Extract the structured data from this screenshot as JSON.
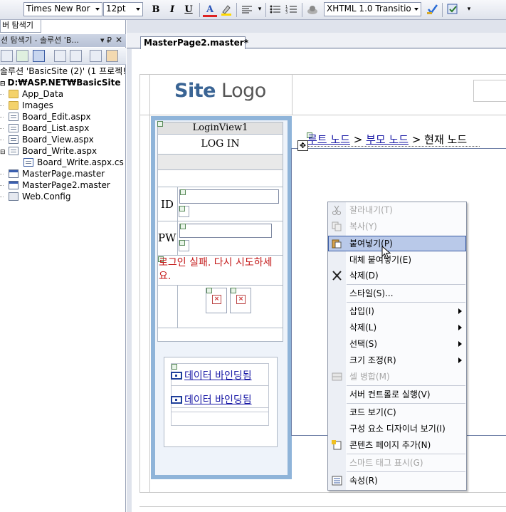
{
  "toolbar": {
    "font_name": "Times New Ror",
    "font_size": "12pt",
    "bold": "B",
    "italic": "I",
    "underline": "U",
    "doctype": "XHTML 1.0 Transitio"
  },
  "solution_explorer": {
    "tab_label": "버 탐색기",
    "title": "션 탐색기 - 솔루션 'B...",
    "pin": "▾ ₽",
    "close": "✕",
    "solution_line": "솔루션 'BasicSite (2)' (1 프로젝!",
    "project": "D:₩ASP.NET₩BasicSite",
    "items": [
      {
        "label": "App_Data",
        "icon": "folder-icon"
      },
      {
        "label": "Images",
        "icon": "folder-icon"
      },
      {
        "label": "Board_Edit.aspx",
        "icon": "page-icon"
      },
      {
        "label": "Board_List.aspx",
        "icon": "page-icon"
      },
      {
        "label": "Board_View.aspx",
        "icon": "page-icon"
      },
      {
        "label": "Board_Write.aspx",
        "icon": "page-icon"
      },
      {
        "label": "Board_Write.aspx.cs",
        "icon": "code-file-icon"
      },
      {
        "label": "MasterPage.master",
        "icon": "master-page-icon"
      },
      {
        "label": "MasterPage2.master",
        "icon": "master-page-icon"
      },
      {
        "label": "Web.Config",
        "icon": "config-icon"
      }
    ]
  },
  "document": {
    "tab_label": "MasterPage2.master*"
  },
  "designer": {
    "logo_bold": "Site",
    "logo_light": " Logo",
    "login_view": {
      "header": "LoginView1",
      "title": "LOG IN",
      "id_label": "ID",
      "pw_label": "PW",
      "failure_text": "로그인 실패. 다시 시도하세요."
    },
    "data_bound": [
      "데이터 바인딩됨",
      "데이터 바인딩됨"
    ],
    "breadcrumb": {
      "root": "루트 노드",
      "sep1": " > ",
      "parent": "부모 노드",
      "sep2": " > ",
      "current": "현재 노드"
    }
  },
  "context_menu": {
    "items": [
      {
        "label": "잘라내기(T)",
        "disabled": true,
        "icon": "scissors-icon"
      },
      {
        "label": "복사(Y)",
        "disabled": true,
        "icon": "copy-icon"
      },
      {
        "label": "붙여넣기(P)",
        "highlighted": true,
        "icon": "paste-icon"
      },
      {
        "label": "대체 붙여넣기(E)"
      },
      {
        "label": "삭제(D)",
        "icon": "delete-x-icon"
      },
      {
        "label": "스타일(S)..."
      },
      {
        "label": "삽입(I)",
        "submenu": true
      },
      {
        "label": "삭제(L)",
        "submenu": true
      },
      {
        "label": "선택(S)",
        "submenu": true
      },
      {
        "label": "크기 조정(R)",
        "submenu": true
      },
      {
        "label": "셀 병합(M)",
        "disabled": true,
        "icon": "merge-cells-icon"
      },
      {
        "label": "서버 컨트롤로 실행(V)"
      },
      {
        "label": "코드 보기(C)"
      },
      {
        "label": "구성 요소 디자이너 보기(I)"
      },
      {
        "label": "콘텐츠 페이지 추가(N)",
        "icon": "add-content-page-icon"
      },
      {
        "label": "스마트 태그 표시(G)",
        "disabled": true
      },
      {
        "label": "속성(R)",
        "icon": "properties-icon"
      }
    ]
  }
}
